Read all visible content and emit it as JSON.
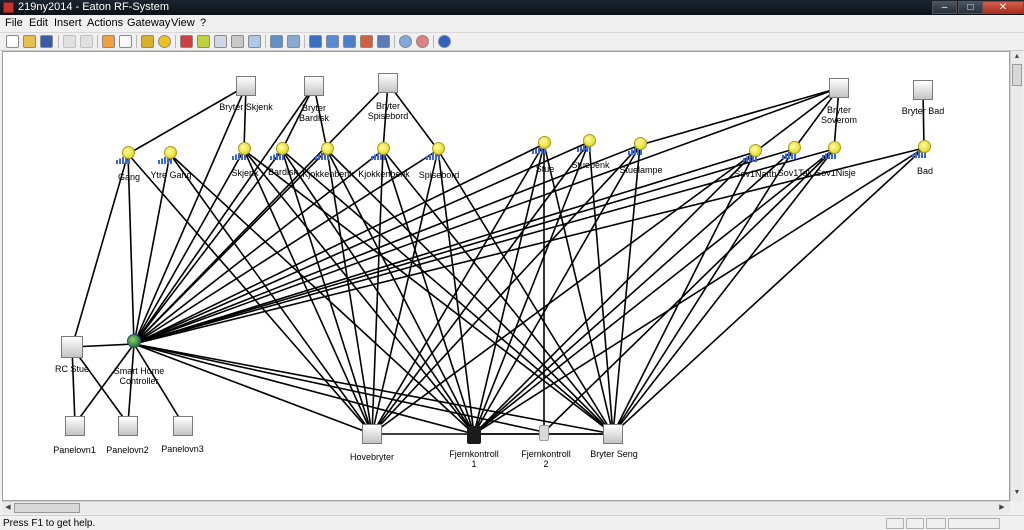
{
  "window": {
    "title": "219ny2014 - Eaton RF-System",
    "controls": [
      "–",
      "□",
      "✕"
    ]
  },
  "menu": [
    "File",
    "Edit",
    "Insert",
    "Actions",
    "Gateway",
    "View",
    "?"
  ],
  "status": {
    "help": "Press F1 to get help."
  },
  "devices": {
    "switches": {
      "skjenk": "Bryter Skjenk",
      "bardisk": "Bryter\nBardisk",
      "spisebord": "Bryter\nSpisebord",
      "soverom": "Bryter\nSoverom",
      "bad": "Bryter Bad"
    },
    "lights": {
      "gang": "Gang",
      "ytre_gang": "Ytre Gang",
      "skjenk": "Skjenk",
      "bardisk": "Bardisk",
      "kjokkenbenk": "Kjokkenbenk",
      "kjokkenbenk2": "Kjokkenbenk",
      "spisebord": "Spisebord",
      "stue": "Stue",
      "stuebenk": "Stuebenk",
      "stuelampe": "Stuelampe",
      "sov1_nattbord": "Sov1Nattb",
      "sov1_tak": "Sov1Tak",
      "sov1_nisje": "Sov1Nisje",
      "bad": "Bad"
    },
    "controller": "Smart Home\nController",
    "rc_stue": "RC Stue",
    "panelovn1": "Panelovn1",
    "panelovn2": "Panelovn2",
    "panelovn3": "Panelovn3",
    "hovebryter": "Hovebryter",
    "fjernkontroll1": "Fjernkontroll\n1",
    "fjernkontroll2": "Fjernkontroll\n2",
    "bryter_seng": "Bryter Seng"
  },
  "colors": {
    "titlebar": "#121820",
    "link": "#000000",
    "light_bulb": "#e8e02a",
    "signal_bars": "#3a66d8"
  },
  "icons": [
    "new-icon",
    "open-icon",
    "save-icon",
    "undo-icon",
    "redo-icon",
    "pencil-icon",
    "select-icon",
    "key-icon",
    "gear-icon",
    "network-icon",
    "link-icon",
    "grid-icon",
    "tools-icon",
    "edit-icon",
    "table-icon",
    "window-icon",
    "monitor-icon",
    "display-icon",
    "panel-icon",
    "transfer-icon",
    "switch-icon",
    "zoom-in-icon",
    "zoom-out-icon",
    "info-icon"
  ]
}
